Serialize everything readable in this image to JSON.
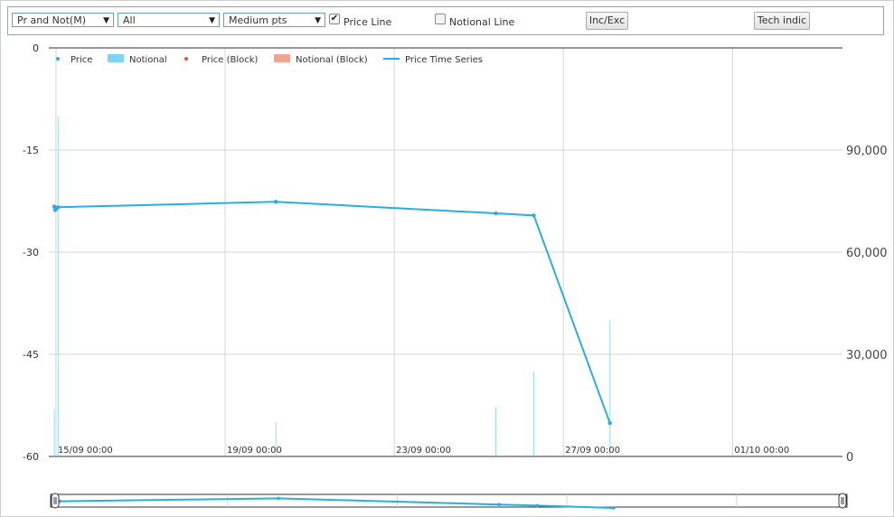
{
  "toolbar": {
    "select1": "Pr and Not(M)",
    "select2": "All",
    "select3": "Medium pts",
    "price_line_label": "Price Line",
    "price_line_checked": "✔",
    "notional_line_label": "Notional Line",
    "inc_exc_label": "Inc/Exc",
    "tech_indic_label": "Tech indic",
    "caret": "▼"
  },
  "chart_data": {
    "type": "line",
    "legend": [
      "Price",
      "Notional",
      "Price (Block)",
      "Notional (Block)",
      "Price Time Series"
    ],
    "legend_colors": [
      "#29aee3",
      "#7fd3f7",
      "#e8503a",
      "#f4a391",
      "#29aee3"
    ],
    "left_axis": {
      "ticks": [
        "0",
        "-15",
        "-30",
        "-45",
        "-60"
      ],
      "ylim": [
        -60,
        0
      ]
    },
    "right_axis": {
      "ticks": [
        "90,000",
        "60,000",
        "30,000",
        "0"
      ],
      "ylim": [
        0,
        120000
      ]
    },
    "x_ticks": [
      "15/09 00:00",
      "19/09 00:00",
      "23/09 00:00",
      "27/09 00:00",
      "01/10 00:00"
    ],
    "x_tick_days": [
      0,
      4,
      8,
      12,
      16
    ],
    "xlim_days": [
      -0.17,
      18.6
    ],
    "price_series": [
      {
        "x": -0.04,
        "y": -23.3
      },
      {
        "x": -0.02,
        "y": -23.8
      },
      {
        "x": 0.0,
        "y": -23.6
      },
      {
        "x": 0.05,
        "y": -23.4
      },
      {
        "x": 5.2,
        "y": -22.6
      },
      {
        "x": 10.4,
        "y": -24.3
      },
      {
        "x": 11.3,
        "y": -24.6
      },
      {
        "x": 13.1,
        "y": -55.1
      }
    ],
    "notional_bars": [
      {
        "x": -0.04,
        "v": 14000
      },
      {
        "x": 0.05,
        "v": 100000
      },
      {
        "x": 5.2,
        "v": 10000
      },
      {
        "x": 10.4,
        "v": 14500
      },
      {
        "x": 11.3,
        "v": 25000
      },
      {
        "x": 13.1,
        "v": 40000
      }
    ],
    "grid": true
  }
}
